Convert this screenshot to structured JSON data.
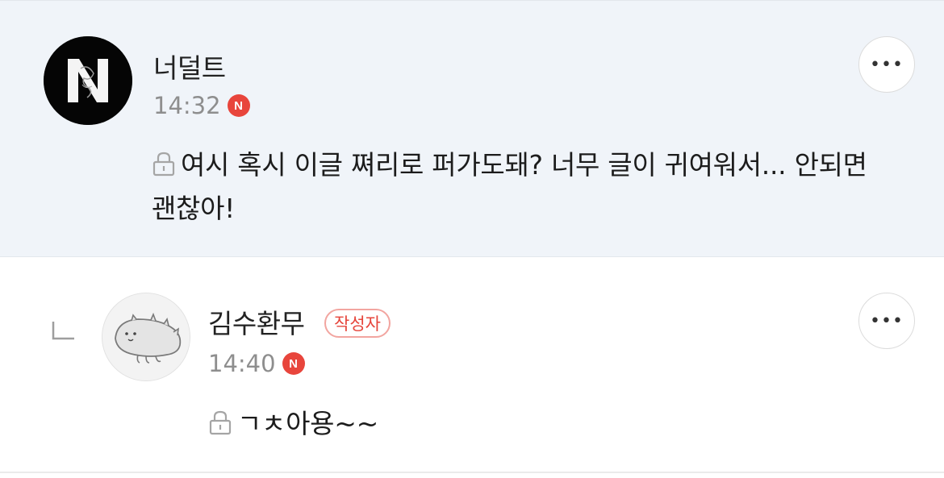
{
  "comments": [
    {
      "author": "너덜트",
      "time": "14:32",
      "new_badge": "N",
      "text": "여시 혹시 이글 쪄리로 퍼가도돼? 너무 글이 귀여워서... 안되면 괜찮아!",
      "more_label": "•••"
    },
    {
      "author": "김수환무",
      "writer_badge": "작성자",
      "time": "14:40",
      "new_badge": "N",
      "text": "ㄱㅊ아용~~",
      "more_label": "•••"
    }
  ],
  "colors": {
    "highlight_bg": "#f0f4f9",
    "new_badge": "#e8453c",
    "writer_badge": "#e6453b"
  }
}
